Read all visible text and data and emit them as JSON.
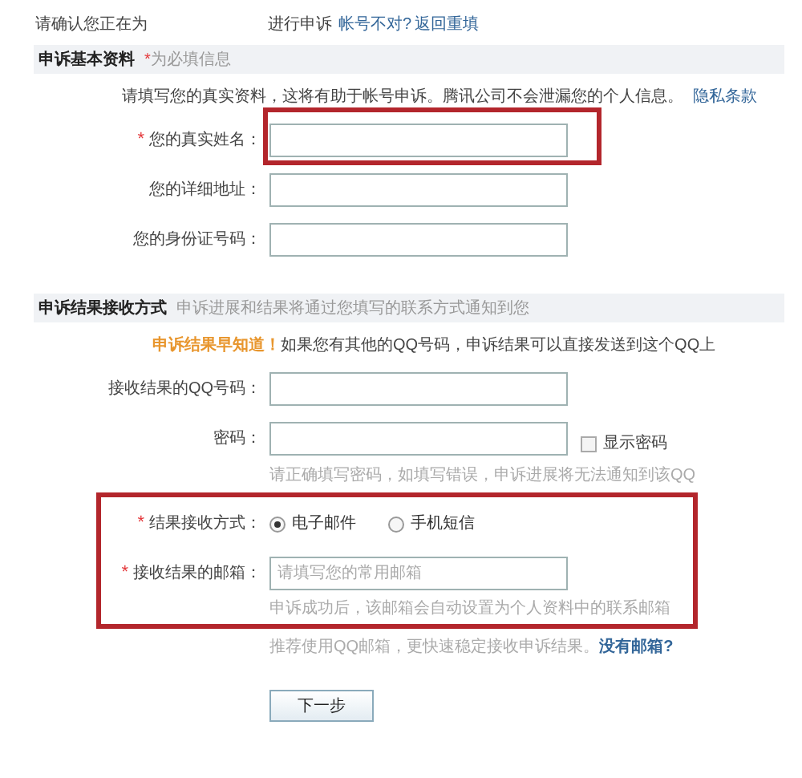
{
  "confirm": {
    "text": "请确认您正在为",
    "action": "进行申诉",
    "wrong_account": "帐号不对?",
    "back_link": "返回重填"
  },
  "basic_section": {
    "title": "申诉基本资料",
    "required_mark": "*",
    "required_note": "为必填信息",
    "intro": "请填写您的真实资料，这将有助于帐号申诉。腾讯公司不会泄漏您的个人信息。",
    "privacy_link": "隐私条款",
    "fields": [
      {
        "label": "您的真实姓名：",
        "required": true,
        "highlighted": true
      },
      {
        "label": "您的详细地址：",
        "required": false,
        "highlighted": false
      },
      {
        "label": "您的身份证号码：",
        "required": false,
        "highlighted": false
      }
    ]
  },
  "result_section": {
    "title": "申诉结果接收方式",
    "subtitle": "申诉进展和结果将通过您填写的联系方式通知到您",
    "notice_highlight": "申诉结果早知道！",
    "notice": "如果您有其他的QQ号码，申诉结果可以直接发送到这个QQ上",
    "qq_label": "接收结果的QQ号码：",
    "password_label": "密码：",
    "show_password": {
      "label": "显示密码",
      "checked": false
    },
    "password_hint": "请正确填写密码，如填写错误，申诉进展将无法通知到该QQ",
    "method_group": {
      "highlighted": true,
      "label": "结果接收方式：",
      "required": true,
      "options": [
        {
          "label": "电子邮件",
          "selected": true
        },
        {
          "label": "手机短信",
          "selected": false
        }
      ],
      "email_label": "接收结果的邮箱：",
      "email_required": true,
      "email_placeholder": "请填写您的常用邮箱",
      "email_hint": "申诉成功后，该邮箱会自动设置为个人资料中的联系邮箱"
    },
    "recommend": "推荐使用QQ邮箱，更快速稳定接收申诉结果。",
    "no_email_link": "没有邮箱?"
  },
  "next_button": "下一步"
}
